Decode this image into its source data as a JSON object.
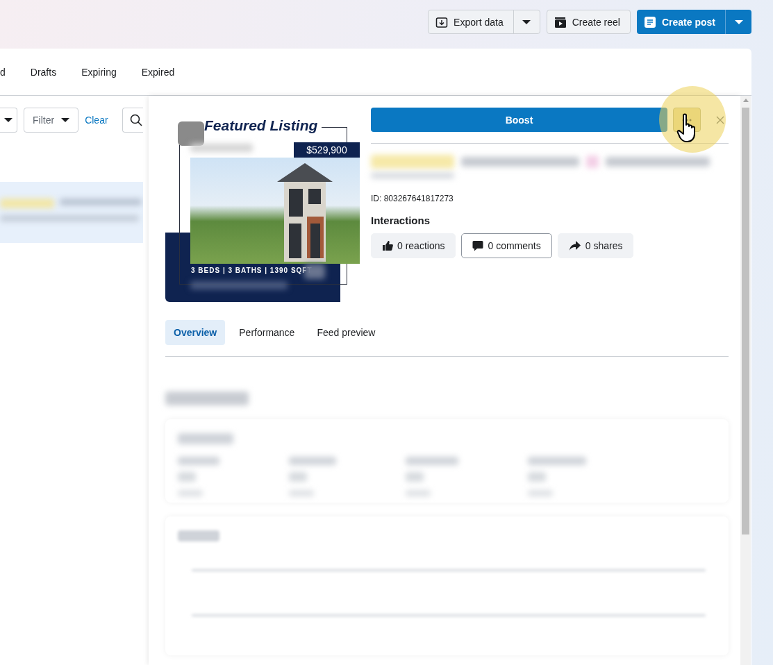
{
  "header_actions": [
    {
      "label": "Export data",
      "primary": false,
      "split": true
    },
    {
      "label": "Create reel",
      "primary": false,
      "split": false
    },
    {
      "label": "Create post",
      "primary": true,
      "split": true
    }
  ],
  "status_tabs": [
    {
      "label": "d",
      "selected": false
    },
    {
      "label": "Drafts",
      "selected": false
    },
    {
      "label": "Expiring",
      "selected": false
    },
    {
      "label": "Expired",
      "selected": false
    }
  ],
  "filters": {
    "filter_label": "Filter",
    "clear_link": "Clear"
  },
  "detail": {
    "preview": {
      "title": "Featured Listing",
      "price": "$529,900",
      "caption": "3 BEDS | 3 BATHS | 1390 SQFT"
    },
    "boost_label": "Boost",
    "post_id": "ID: 803267641817273",
    "interactions_heading": "Interactions",
    "interactions": [
      {
        "label": "0 reactions",
        "selected": false
      },
      {
        "label": "0 comments",
        "selected": true
      },
      {
        "label": "0 shares",
        "selected": false
      }
    ],
    "tabs": [
      {
        "label": "Overview",
        "selected": true
      },
      {
        "label": "Performance",
        "selected": false
      },
      {
        "label": "Feed preview",
        "selected": false
      }
    ]
  }
}
